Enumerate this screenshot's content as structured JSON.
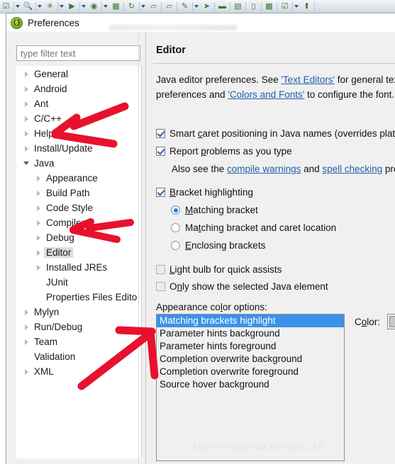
{
  "toolbar": {
    "icons": [
      {
        "name": "checkmark-icon",
        "glyph": "☑"
      },
      {
        "name": "caret-down-icon",
        "glyph": "▾"
      },
      {
        "name": "search-icon",
        "glyph": "🔍"
      },
      {
        "name": "caret-down-icon",
        "glyph": "▾"
      },
      {
        "name": "debug-bug-icon",
        "glyph": "✳"
      },
      {
        "name": "caret-down-icon",
        "glyph": "▾"
      },
      {
        "name": "run-icon",
        "glyph": "▶"
      },
      {
        "name": "caret-down-icon",
        "glyph": "▾"
      },
      {
        "name": "coverage-icon",
        "glyph": "◉"
      },
      {
        "name": "caret-down-icon",
        "glyph": "▾"
      },
      {
        "name": "package-icon",
        "glyph": "▦"
      },
      {
        "name": "refresh-icon",
        "glyph": "↻"
      },
      {
        "name": "caret-down-icon",
        "glyph": "▾"
      },
      {
        "name": "open-folder-icon",
        "glyph": "▱"
      },
      {
        "name": "open-type-icon",
        "glyph": "▱"
      },
      {
        "name": "pencil-icon",
        "glyph": "✎"
      },
      {
        "name": "caret-down-icon",
        "glyph": "▾"
      },
      {
        "name": "cursor-icon",
        "glyph": "➤"
      },
      {
        "name": "marker-icon",
        "glyph": "▬"
      },
      {
        "name": "outline-icon",
        "glyph": "▤"
      },
      {
        "name": "compare-icon",
        "glyph": "▯"
      },
      {
        "name": "table-icon",
        "glyph": "▩"
      },
      {
        "name": "checklist-icon",
        "glyph": "☑"
      },
      {
        "name": "caret-down-icon",
        "glyph": "▾"
      },
      {
        "name": "upload-icon",
        "glyph": "⬆"
      }
    ]
  },
  "dialog": {
    "title": "Preferences",
    "icon_glyph": "{}"
  },
  "filter": {
    "placeholder": "type filter text",
    "value": ""
  },
  "tree": {
    "items": [
      {
        "label": "General",
        "indent": 0,
        "twisty": "closed",
        "selected": false
      },
      {
        "label": "Android",
        "indent": 0,
        "twisty": "closed",
        "selected": false
      },
      {
        "label": "Ant",
        "indent": 0,
        "twisty": "closed",
        "selected": false
      },
      {
        "label": "C/C++",
        "indent": 0,
        "twisty": "closed",
        "selected": false
      },
      {
        "label": "Help",
        "indent": 0,
        "twisty": "closed",
        "selected": false
      },
      {
        "label": "Install/Update",
        "indent": 0,
        "twisty": "closed",
        "selected": false
      },
      {
        "label": "Java",
        "indent": 0,
        "twisty": "open",
        "selected": false
      },
      {
        "label": "Appearance",
        "indent": 1,
        "twisty": "closed",
        "selected": false
      },
      {
        "label": "Build Path",
        "indent": 1,
        "twisty": "closed",
        "selected": false
      },
      {
        "label": "Code Style",
        "indent": 1,
        "twisty": "closed",
        "selected": false
      },
      {
        "label": "Compiler",
        "indent": 1,
        "twisty": "closed",
        "selected": false
      },
      {
        "label": "Debug",
        "indent": 1,
        "twisty": "closed",
        "selected": false
      },
      {
        "label": "Editor",
        "indent": 1,
        "twisty": "closed",
        "selected": true
      },
      {
        "label": "Installed JREs",
        "indent": 1,
        "twisty": "closed",
        "selected": false
      },
      {
        "label": "JUnit",
        "indent": 1,
        "twisty": "none",
        "selected": false
      },
      {
        "label": "Properties Files Edito",
        "indent": 1,
        "twisty": "none",
        "selected": false
      },
      {
        "label": "Mylyn",
        "indent": 0,
        "twisty": "closed",
        "selected": false
      },
      {
        "label": "Run/Debug",
        "indent": 0,
        "twisty": "closed",
        "selected": false
      },
      {
        "label": "Team",
        "indent": 0,
        "twisty": "closed",
        "selected": false
      },
      {
        "label": "Validation",
        "indent": 0,
        "twisty": "none",
        "selected": false
      },
      {
        "label": "XML",
        "indent": 0,
        "twisty": "closed",
        "selected": false
      }
    ]
  },
  "editor_page": {
    "title": "Editor",
    "description_line1_a": "Java editor preferences. See ",
    "description_line1_link": "'Text Editors'",
    "description_line1_b": " for general text e",
    "description_line2_a": "preferences and ",
    "description_line2_link": "'Colors and Fonts'",
    "description_line2_b": " to configure the font.",
    "smart_caret_label_a": "Smart ",
    "smart_caret_label_u": "c",
    "smart_caret_label_b": "aret positioning in Java names (overrides platfor",
    "smart_caret_checked": true,
    "report_problems_label_a": "Report ",
    "report_problems_label_u": "p",
    "report_problems_label_b": "roblems as you type",
    "report_problems_checked": true,
    "also_see_a": "Also see the ",
    "also_see_link1": "compile warnings",
    "also_see_b": " and ",
    "also_see_link2": "spell checking",
    "also_see_c": " prefe",
    "bracket_highlighting_label_u": "B",
    "bracket_highlighting_label_b": "racket highlighting",
    "bracket_highlighting_checked": true,
    "radio_matching_u": "M",
    "radio_matching_b": "atching bracket",
    "radio_matching_selected": true,
    "radio_matching_caret_a": "Ma",
    "radio_matching_caret_u": "t",
    "radio_matching_caret_b": "ching bracket and caret location",
    "radio_matching_caret_selected": false,
    "radio_enclosing_u": "E",
    "radio_enclosing_b": "nclosing brackets",
    "radio_enclosing_selected": false,
    "light_bulb_label_u": "L",
    "light_bulb_label_b": "ight bulb for quick assists",
    "light_bulb_checked": false,
    "only_show_label_a": "O",
    "only_show_label_u": "n",
    "only_show_label_b": "ly show the selected Java element",
    "only_show_checked": false,
    "appearance_label_a": "Appearance co",
    "appearance_label_u": "l",
    "appearance_label_b": "or options:",
    "color_label_a": "C",
    "color_label_u": "o",
    "color_label_b": "lor:",
    "color_swatch_hex": "#c8c8c8",
    "selection_hex": "#3b92e8",
    "color_options": [
      {
        "label": "Matching brackets highlight",
        "selected": true
      },
      {
        "label": "Parameter hints background",
        "selected": false
      },
      {
        "label": "Parameter hints foreground",
        "selected": false
      },
      {
        "label": "Completion overwrite background",
        "selected": false
      },
      {
        "label": "Completion overwrite foreground",
        "selected": false
      },
      {
        "label": "Source hover background",
        "selected": false
      }
    ]
  },
  "annotations": {
    "color": "#e8112d",
    "arrows": [
      {
        "name": "arrow-pointing-java"
      },
      {
        "name": "arrow-pointing-editor"
      },
      {
        "name": "arrow-pointing-completion-overwrite-background"
      }
    ]
  },
  "watermark": {
    "text": "http://blog.csdn.net/juyo_ch"
  }
}
